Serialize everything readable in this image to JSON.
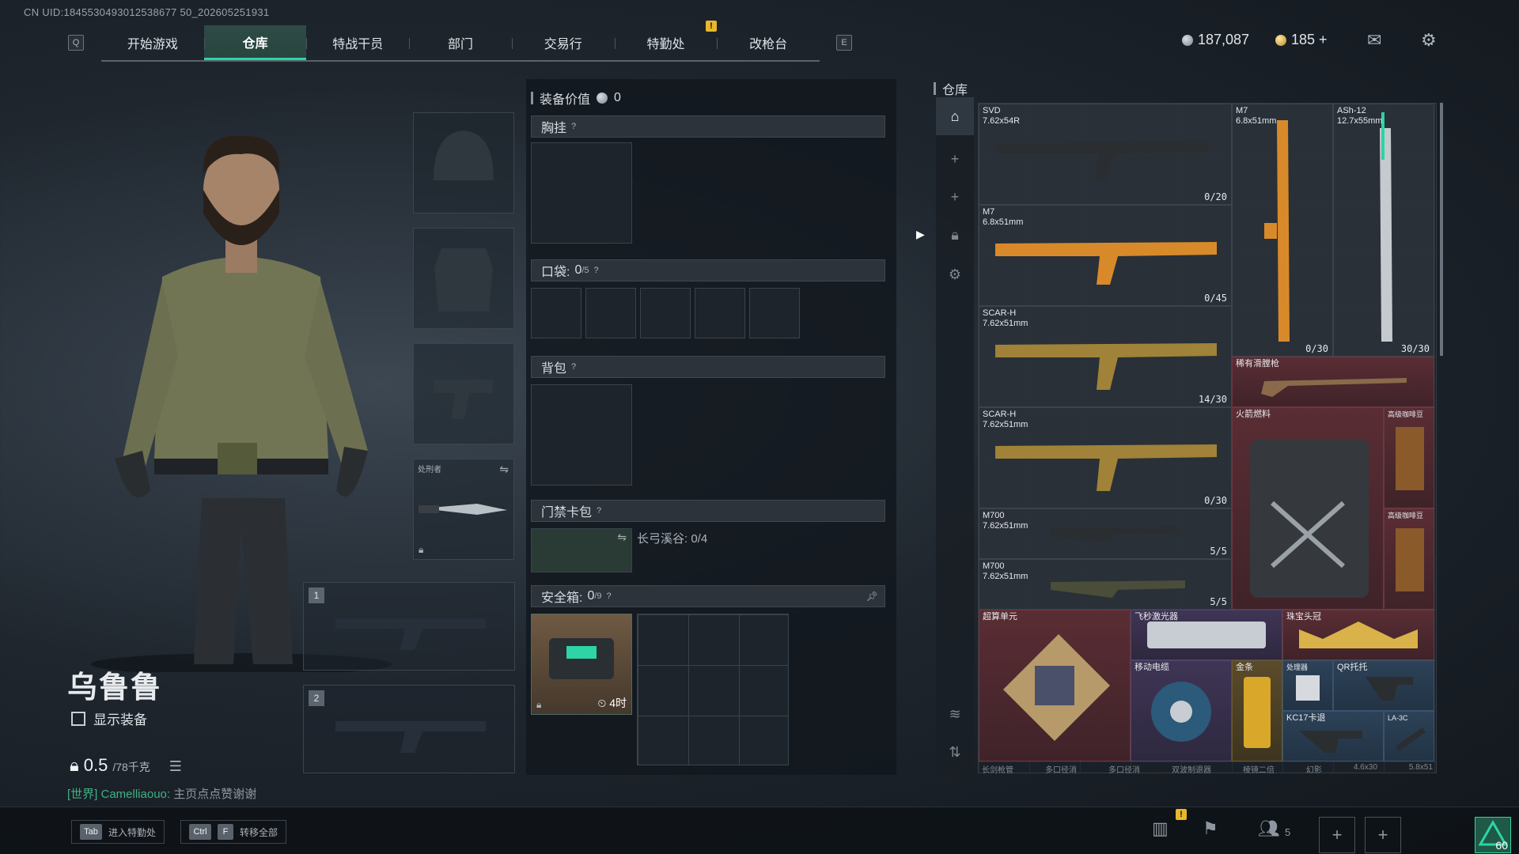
{
  "uid": "CN UID:1845530493012538677 50_202605251931",
  "nav": {
    "left_key": "Q",
    "right_key": "E",
    "tabs": [
      "开始游戏",
      "仓库",
      "特战干员",
      "部门",
      "交易行",
      "特勤处",
      "改枪台"
    ],
    "active": "仓库",
    "alert": "!"
  },
  "currency": {
    "silver": "187,087",
    "gold": "185 +"
  },
  "character": {
    "name": "乌鲁鲁",
    "show_equipment_label": "显示装备",
    "weight": "0.5",
    "weight_max": "/78千克"
  },
  "chat": {
    "channel": "[世界] Camelliaouo:",
    "message": "主页点点赞谢谢"
  },
  "melee": {
    "name": "处刑者"
  },
  "weapon_slots": [
    "1",
    "2"
  ],
  "middle": {
    "equip_value_label": "装备价值",
    "equip_value": "0",
    "chest_rig": "胸挂",
    "pockets": "口袋:",
    "pockets_count": "0",
    "pockets_max": "/5",
    "backpack": "背包",
    "keycard": "门禁卡包",
    "keycard_detail": "长弓溪谷: 0/4",
    "safebox": "安全箱:",
    "safebox_count": "0",
    "safebox_max": "/9",
    "safebox_timer": "4时",
    "help": "?"
  },
  "warehouse": {
    "title": "仓库",
    "items": [
      {
        "name": "SVD",
        "caliber": "7.62x54R",
        "count": "0/20"
      },
      {
        "name": "M7",
        "caliber": "6.8x51mm",
        "count": "0/45"
      },
      {
        "name": "SCAR-H",
        "caliber": "7.62x51mm",
        "count": "14/30"
      },
      {
        "name": "SCAR-H",
        "caliber": "7.62x51mm",
        "count": "0/30"
      },
      {
        "name": "M700",
        "caliber": "7.62x51mm",
        "count": "5/5"
      },
      {
        "name": "M700",
        "caliber": "7.62x51mm",
        "count": "5/5"
      },
      {
        "name": "M7",
        "caliber": "6.8x51mm",
        "count": "0/30"
      },
      {
        "name": "ASh-12",
        "caliber": "12.7x55mm",
        "count": "30/30"
      },
      {
        "name": "稀有滑膛枪"
      },
      {
        "name": "火箭燃料"
      },
      {
        "name": "高级咖啡豆"
      },
      {
        "name": "高级咖啡豆"
      },
      {
        "name": "超算单元"
      },
      {
        "name": "飞秒激光器"
      },
      {
        "name": "珠宝头冠"
      },
      {
        "name": "移动电缆"
      },
      {
        "name": "金条"
      },
      {
        "name": "处理器"
      },
      {
        "name": "QR托托"
      },
      {
        "name": "KC17卡退"
      },
      {
        "name": "LA-3C"
      }
    ],
    "footer": [
      "长剑枪管",
      "多口径消",
      "多口径消",
      "双波制退器",
      "棱镜二倍",
      "幻影",
      "4.6x30",
      "5.8x51"
    ]
  },
  "bottom": {
    "hint1_key": "Tab",
    "hint1_label": "进入特勤处",
    "hint2_key1": "Ctrl",
    "hint2_key2": "F",
    "hint2_label": "转移全部",
    "friends_count": "5",
    "level": "60",
    "alert": "!"
  }
}
